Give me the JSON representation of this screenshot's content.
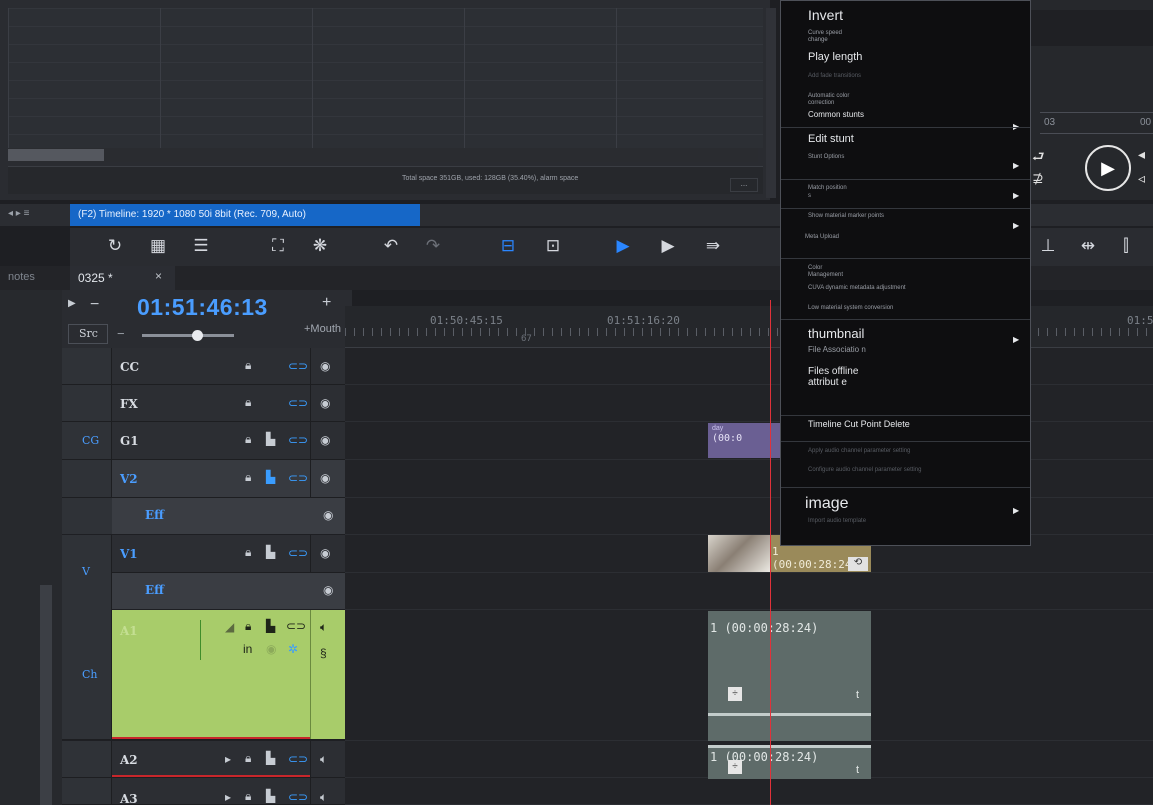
{
  "bin": {
    "status_text": "Total space 351GB, used: 128GB (35.40%), alarm space",
    "more_label": "..."
  },
  "player": {
    "ruler_left": "03",
    "ruler_right": "00"
  },
  "timeline": {
    "title": "(F2) Timeline: 1920 * 1080 50i 8bit (Rec. 709, Auto)",
    "sequence_tab": "0325 *",
    "close_label": "×",
    "notes_label": "notes",
    "timecode": "01:51:46:13",
    "src_label": "Src",
    "mouth_label": "+Mouth",
    "ruler": {
      "label1": "01:50:45:15",
      "label2": "01:51:16:20",
      "label3": "01:5",
      "sub1": "67"
    }
  },
  "tracks": [
    {
      "group": "",
      "name": "CC"
    },
    {
      "group": "",
      "name": "FX"
    },
    {
      "group": "CG",
      "name": "G1"
    },
    {
      "group": "",
      "name": "V2",
      "eff": "Eff"
    },
    {
      "group": "V",
      "name": "V1",
      "eff": "Eff"
    },
    {
      "group": "Ch",
      "name": "A1",
      "in_label": "in"
    },
    {
      "group": "",
      "name": "A2"
    },
    {
      "group": "",
      "name": "A3"
    }
  ],
  "clips": {
    "g1_top": "day",
    "g1_text": "(00:0",
    "v1_text": "1 (00:00:28:24)",
    "a1_text": "1 (00:00:28:24)",
    "a2_text": "1 (00:00:28:24)",
    "t_label": "t"
  },
  "context_menu": {
    "invert": "Invert",
    "curve_speed": "Curve speed change",
    "play_length": "Play length",
    "faded1": "Add fade transitions",
    "auto_color": "Automatic color correction",
    "common_stunts": "Common stunts",
    "edit_stunt": "Edit stunt",
    "stunt_options": "Stunt Options",
    "match_positions": "Match position",
    "match_s": "s",
    "show_marker": "Show material marker points",
    "meta_upload": "Meta Upload",
    "color_mgmt": "Color Management",
    "cuva": "CUVA dynamic metadata adjustment",
    "low_material": "Low material system conversion",
    "thumbnail": "thumbnail",
    "file_assoc": "File Associatio n",
    "files_offline": "Files offline attribut e",
    "cut_point_delete": "Timeline Cut Point Delete",
    "faded2": "Apply audio channel parameter setting",
    "faded3": "Configure audio channel parameter setting",
    "image": "image",
    "faded4": "Import audio template"
  },
  "colors": {
    "accent": "#1667c7",
    "timecode": "#4a9dff",
    "playhead": "#e0323a",
    "audio_track": "#a8cc6a",
    "cg_clip": "#6a5f93",
    "video_clip": "#9a8a5a",
    "audio_clip": "#5e6b69"
  }
}
